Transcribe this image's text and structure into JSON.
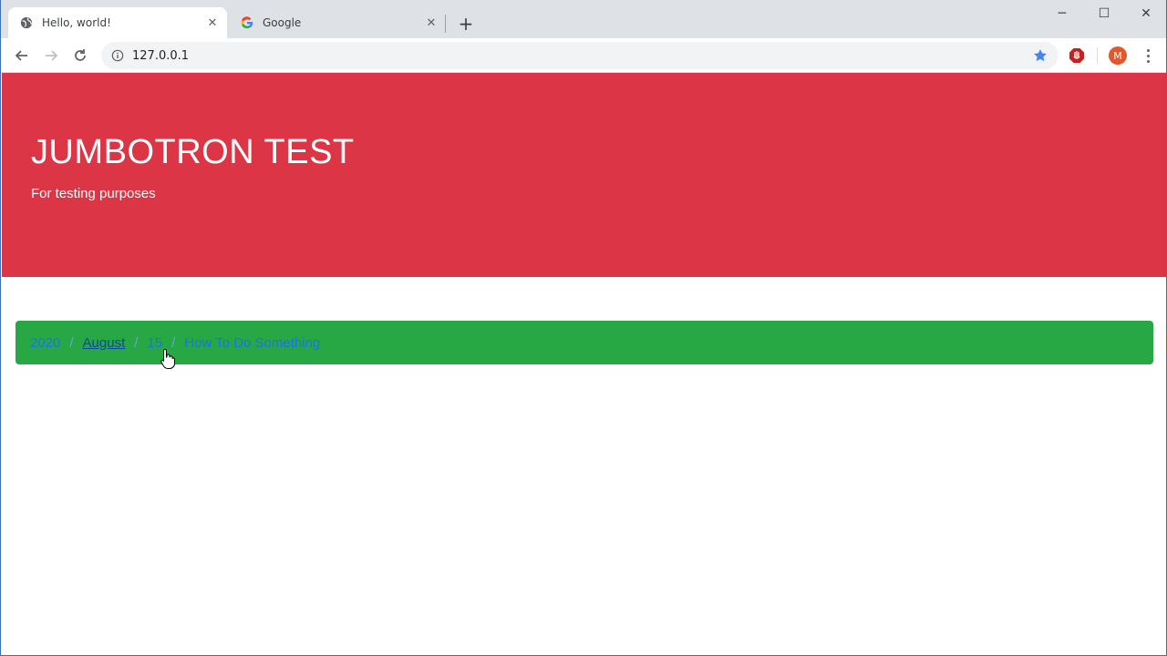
{
  "browser": {
    "tabs": [
      {
        "title": "Hello, world!",
        "active": true,
        "favicon": "globe-icon"
      },
      {
        "title": "Google",
        "active": false,
        "favicon": "google-icon"
      }
    ],
    "close_glyph": "✕",
    "new_tab_glyph": "+",
    "window_controls": {
      "minimize": "─",
      "maximize": "☐",
      "close": "✕"
    },
    "address_bar": {
      "url": "127.0.0.1"
    },
    "profile_initial": "M"
  },
  "page": {
    "jumbotron": {
      "title": "JUMBOTRON TEST",
      "subtitle": "For testing purposes",
      "background_color": "#dc3545"
    },
    "breadcrumb": {
      "background_color": "#28a745",
      "items": [
        {
          "label": "2020"
        },
        {
          "label": "August"
        },
        {
          "label": "15"
        },
        {
          "label": "How To Do Something"
        }
      ],
      "separator": "/"
    }
  }
}
